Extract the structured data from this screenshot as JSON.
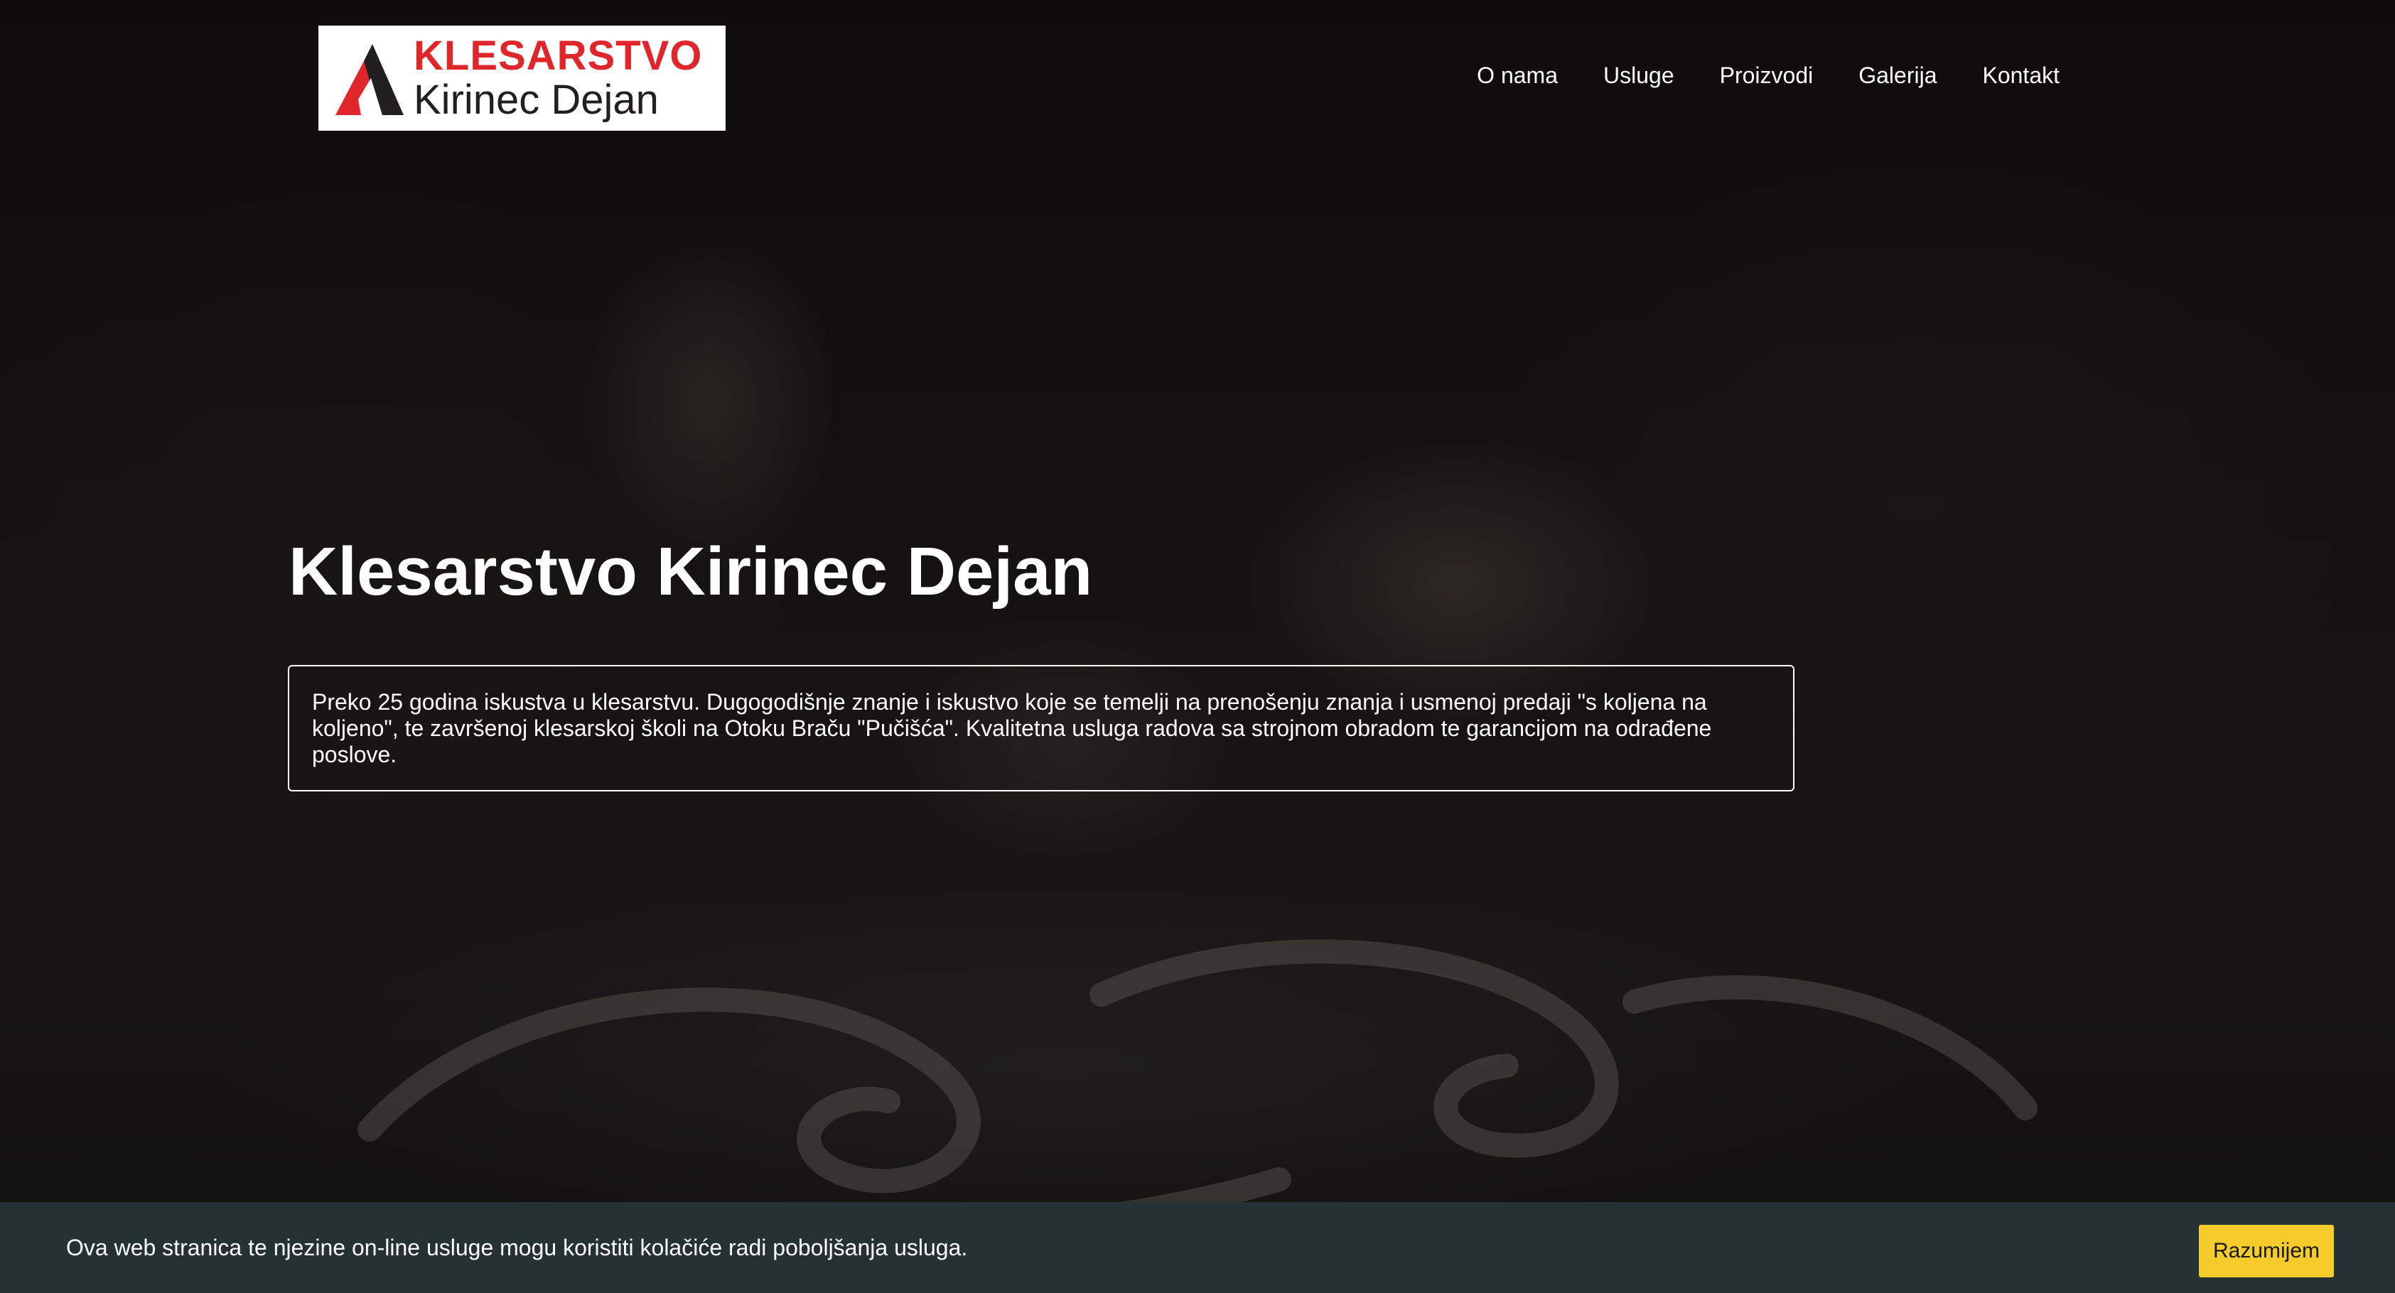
{
  "header": {
    "logo": {
      "line1": "KLESARSTVO",
      "line2": "Kirinec Dejan",
      "icon": "mountain-logo-icon",
      "colors": {
        "accent": "#e1262b",
        "dark": "#231f20"
      }
    },
    "nav": [
      {
        "label": "O nama"
      },
      {
        "label": "Usluge"
      },
      {
        "label": "Proizvodi"
      },
      {
        "label": "Galerija"
      },
      {
        "label": "Kontakt"
      }
    ]
  },
  "hero": {
    "title": "Klesarstvo Kirinec Dejan",
    "description": "Preko 25 godina iskustva u klesarstvu. Dugogodišnje znanje i iskustvo koje se temelji na prenošenju znanja i usmenoj predaji \"s koljena na koljeno\", te završenoj klesarskoj školi na Otoku Braču \"Pučišća\". Kvalitetna usluga radova sa strojnom obradom te garancijom na odrađene poslove."
  },
  "cookie_bar": {
    "text": "Ova web stranica te njezine on-line usluge mogu koristiti kolačiće radi poboljšanja usluga.",
    "button_label": "Razumijem",
    "colors": {
      "background": "#263133",
      "button": "#f5cc2c"
    }
  }
}
